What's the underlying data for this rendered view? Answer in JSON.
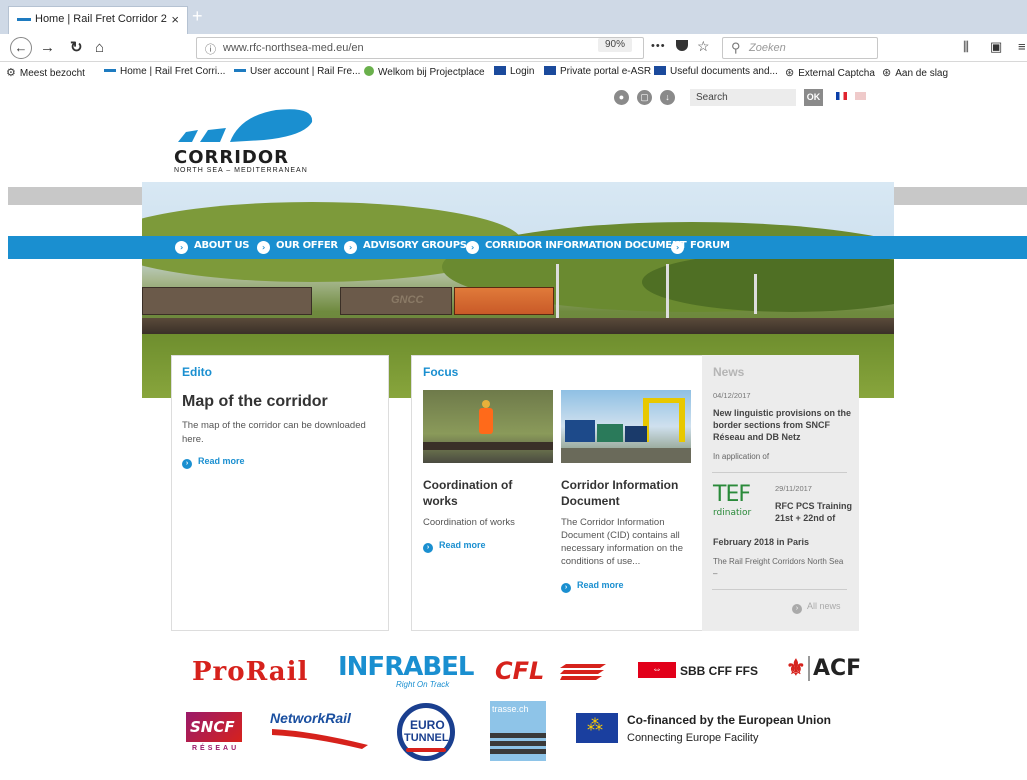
{
  "browser": {
    "tab_title": "Home | Rail Fret Corridor 2",
    "tab_close": "×",
    "new_tab": "+",
    "url": "www.rfc-northsea-med.eu/en",
    "zoom": "90%",
    "menu_dots": "•••",
    "search_placeholder": "Zoeken",
    "bookmarks": [
      "Meest bezocht",
      "Home | Rail Fret Corri...",
      "User account | Rail Fre...",
      "Welkom bij Projectplace",
      "Login",
      "Private portal e-ASR",
      "Useful documents and...",
      "External Captcha",
      "Aan de slag"
    ]
  },
  "site": {
    "search_placeholder": "Search",
    "ok_label": "OK",
    "logo_title": "CORRIDOR",
    "logo_subtitle": "NORTH SEA – MEDITERRANEAN",
    "nav": [
      "ABOUT US",
      "OUR OFFER",
      "ADVISORY GROUPS",
      "CORRIDOR INFORMATION DOCUMENT",
      "FORUM"
    ],
    "hero_wagon_label": "GNCC"
  },
  "edito": {
    "heading": "Edito",
    "title": "Map of the corridor",
    "text": "The map of the corridor can be downloaded here.",
    "read_more": "Read more"
  },
  "focus": {
    "heading": "Focus",
    "items": [
      {
        "title": "Coordination of works",
        "text": "Coordination of works",
        "read_more": "Read more"
      },
      {
        "title": "Corridor Information Document",
        "text": "The Corridor Information Document (CID) contains all necessary information on the conditions of use...",
        "read_more": "Read more"
      }
    ]
  },
  "news": {
    "heading": "News",
    "items": [
      {
        "date": "04/12/2017",
        "title": "New linguistic provisions on the border sections from SNCF Réseau and DB Netz",
        "text": "In application of"
      },
      {
        "date": "29/11/2017",
        "logo_text": "TEF",
        "logo_sub": "rdinatior",
        "title_side": "RFC PCS Training 21st + 22nd of",
        "title_full": "February 2018 in Paris",
        "text": "The Rail Freight Corridors North Sea –"
      }
    ],
    "all_news": "All news"
  },
  "partners": {
    "prorail": "ProRail",
    "infrabel": "INFRABEL",
    "infrabel_tag": "Right On Track",
    "cfl": "CFL",
    "sbb": "SBB CFF FFS",
    "acf": "ACF",
    "sncf": "SNCF",
    "sncf_sub": "RÉSEAU",
    "networkrail": "NetworkRail",
    "eurotunnel_1": "EURO",
    "eurotunnel_2": "TUNNEL",
    "trasse": "trasse.ch",
    "eu_line1": "Co-financed by the European Union",
    "eu_line2": "Connecting Europe Facility"
  },
  "colors": {
    "accent": "#1a8fd0",
    "logo_blue": "#1a8fd0",
    "prorail_red": "#d6221c",
    "infrabel_blue": "#1a8fd0",
    "sbb_red": "#e2001a"
  },
  "icons": [
    "search-icon",
    "back-arrow-icon",
    "forward-arrow-icon",
    "reload-icon",
    "home-icon",
    "star-icon",
    "pocket-icon",
    "library-icon",
    "sidebar-icon",
    "menu-icon"
  ]
}
